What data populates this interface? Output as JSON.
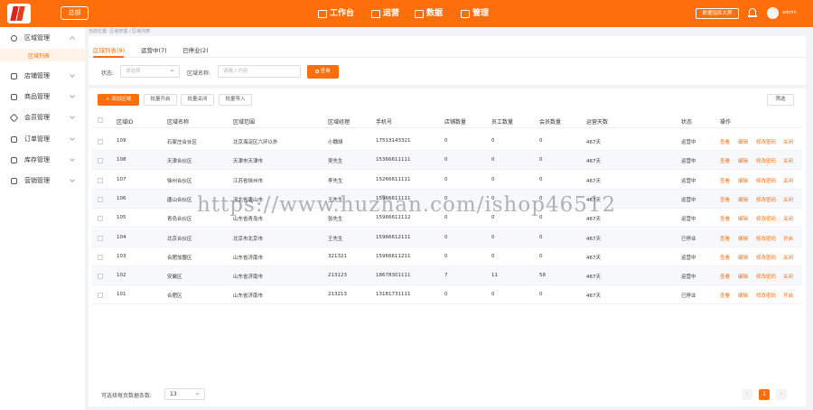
{
  "colors": {
    "accent": "#fe6f0b",
    "logo": "#d8251c"
  },
  "header": {
    "store_button": "总部",
    "nav": [
      {
        "label": "工作台",
        "icon": "monitor-icon"
      },
      {
        "label": "运营",
        "icon": "cart-icon"
      },
      {
        "label": "数据",
        "icon": "bar-chart-icon"
      },
      {
        "label": "管理",
        "icon": "grid-icon"
      }
    ],
    "screen_button": "数据指挥大屏",
    "username": "admin"
  },
  "sidebar": {
    "items": [
      {
        "label": "区域管理",
        "icon": "globe-icon"
      },
      {
        "label": "店铺管理",
        "icon": "store-icon"
      },
      {
        "label": "商品管理",
        "icon": "cart-icon"
      },
      {
        "label": "会员管理",
        "icon": "diamond-icon"
      },
      {
        "label": "订单管理",
        "icon": "order-icon"
      },
      {
        "label": "库存管理",
        "icon": "home-icon"
      },
      {
        "label": "营销管理",
        "icon": "tag-icon"
      }
    ],
    "active_sub": "区域列表"
  },
  "breadcrumb": "当前位置: 区域管理 / 区域列表",
  "tabs": [
    {
      "label": "区域列表(9)"
    },
    {
      "label": "运营中(7)"
    },
    {
      "label": "已停业(2)"
    }
  ],
  "filters": {
    "status_label": "状态:",
    "status_placeholder": "请选择",
    "name_label": "区域名称:",
    "name_placeholder": "请输入内容",
    "search_button": "查询"
  },
  "toolbar": {
    "add": "+ 添加区域",
    "batch_open": "批量开启",
    "batch_close": "批量关闭",
    "batch_import": "批量导入",
    "filter": "筛选"
  },
  "table": {
    "headers": [
      "区域ID",
      "区域名称",
      "区域范围",
      "区域经理",
      "手机号",
      "店铺数量",
      "员工数量",
      "会员数量",
      "运营天数",
      "状态",
      "操作"
    ],
    "rows": [
      {
        "id": "109",
        "name": "石家庄合伙区",
        "scope": "北京海淀区六环以外",
        "manager": "小魏胡",
        "phone": "17513143321",
        "stores": "0",
        "staff": "0",
        "members": "0",
        "days": "467天",
        "status": "运营中",
        "toggle": "关闭"
      },
      {
        "id": "108",
        "name": "天津合伙区",
        "scope": "天津市天津市",
        "manager": "吴先生",
        "phone": "15366611111",
        "stores": "0",
        "staff": "0",
        "members": "0",
        "days": "467天",
        "status": "运营中",
        "toggle": "关闭"
      },
      {
        "id": "107",
        "name": "徐州合伙区",
        "scope": "江苏省徐州市",
        "manager": "李先生",
        "phone": "15266611111",
        "stores": "0",
        "staff": "0",
        "members": "0",
        "days": "467天",
        "status": "运营中",
        "toggle": "关闭"
      },
      {
        "id": "106",
        "name": "唐山合伙区",
        "scope": "河北省唐山市",
        "manager": "王先生",
        "phone": "15966611111",
        "stores": "0",
        "staff": "0",
        "members": "0",
        "days": "467天",
        "status": "运营中",
        "toggle": "关闭"
      },
      {
        "id": "105",
        "name": "青岛合伙区",
        "scope": "山东省青岛市",
        "manager": "张先生",
        "phone": "15966611112",
        "stores": "0",
        "staff": "0",
        "members": "0",
        "days": "467天",
        "status": "运营中",
        "toggle": "关闭"
      },
      {
        "id": "104",
        "name": "北京合伙区",
        "scope": "北京市北京市",
        "manager": "王先生",
        "phone": "15966612111",
        "stores": "0",
        "staff": "0",
        "members": "0",
        "days": "467天",
        "status": "已停业",
        "toggle": "开启"
      },
      {
        "id": "103",
        "name": "合肥加盟区",
        "scope": "山东省济南市",
        "manager": "321321",
        "phone": "15966611211",
        "stores": "0",
        "staff": "0",
        "members": "0",
        "days": "467天",
        "status": "运营中",
        "toggle": "关闭"
      },
      {
        "id": "102",
        "name": "安徽区",
        "scope": "山东省济南市",
        "manager": "213123",
        "phone": "18678301111",
        "stores": "7",
        "staff": "11",
        "members": "58",
        "days": "467天",
        "status": "运营中",
        "toggle": "关闭"
      },
      {
        "id": "101",
        "name": "合肥区",
        "scope": "山东省济南市",
        "manager": "213213",
        "phone": "13181731111",
        "stores": "0",
        "staff": "0",
        "members": "0",
        "days": "467天",
        "status": "已停业",
        "toggle": "开启"
      }
    ],
    "actions": {
      "view": "查看",
      "edit": "编辑",
      "change_password": "修改密码"
    }
  },
  "pagination": {
    "page_size_label": "可选择每页数据条数:",
    "page_size": "13",
    "prev": "‹",
    "current": "1",
    "next": "›"
  },
  "watermark": "https://www.huzhan.com/ishop46512"
}
